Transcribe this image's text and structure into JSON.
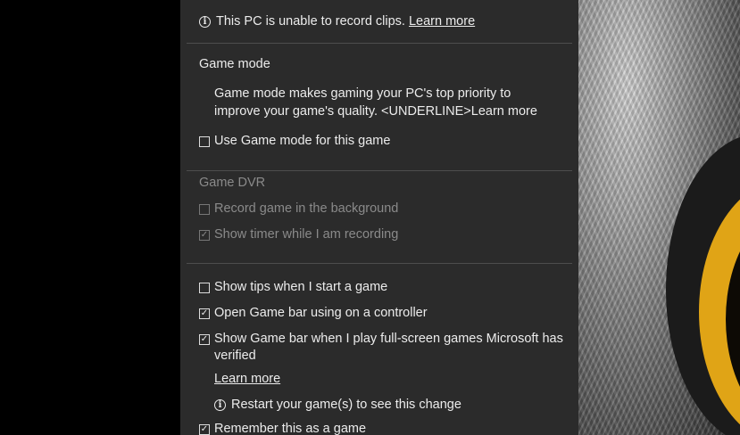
{
  "notice": {
    "text": "This PC is unable to record clips.",
    "link": "Learn more",
    "icon": "info-icon"
  },
  "game_mode": {
    "heading": "Game mode",
    "description_line1": "Game mode makes gaming your PC's top priority to",
    "description_line2": "improve your game's quality. <UNDERLINE>Learn more",
    "checkbox_label": "Use Game mode for this game",
    "checked": false
  },
  "game_dvr": {
    "heading": "Game DVR",
    "options": [
      {
        "label": "Record game in the background",
        "checked": false,
        "enabled": false
      },
      {
        "label": "Show timer while I am recording",
        "checked": true,
        "enabled": false
      }
    ]
  },
  "general": {
    "options": [
      {
        "label": "Show tips when I start a game",
        "checked": false
      },
      {
        "label": "Open Game bar using  on a controller",
        "checked": true
      },
      {
        "label_line1": "Show Game bar when I play full-screen games Microsoft has",
        "label_line2": "verified",
        "checked": true
      }
    ],
    "learn_more": "Learn more",
    "restart_notice": "Restart your game(s) to see this change",
    "remember_label": "Remember this as a game",
    "remember_checked": true
  },
  "colors": {
    "panel_bg": "#2b2b2b",
    "text": "#ececec",
    "disabled_text": "#8a8a8a",
    "divider": "#4d4d4d",
    "eye_accent": "#e0a416"
  }
}
